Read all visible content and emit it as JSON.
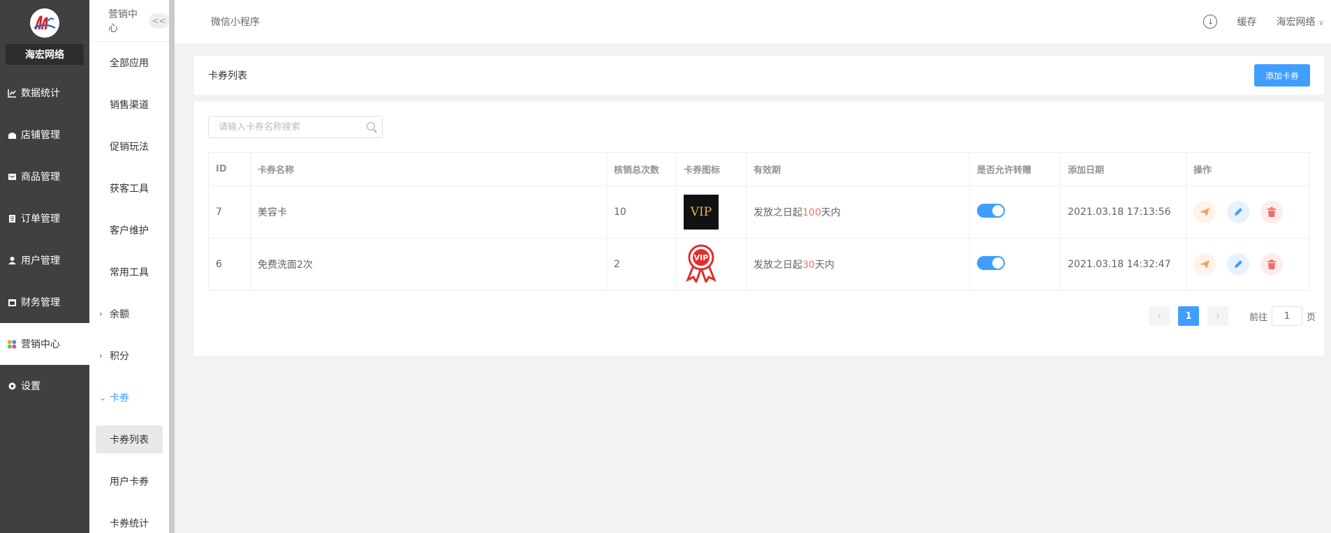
{
  "sidebar": {
    "brand": "海宏网络",
    "items": [
      {
        "label": "数据统计",
        "icon": "chart-line-icon"
      },
      {
        "label": "店铺管理",
        "icon": "shop-icon"
      },
      {
        "label": "商品管理",
        "icon": "goods-icon"
      },
      {
        "label": "订单管理",
        "icon": "order-icon"
      },
      {
        "label": "用户管理",
        "icon": "user-icon"
      },
      {
        "label": "财务管理",
        "icon": "finance-icon"
      },
      {
        "label": "营销中心",
        "icon": "marketing-icon",
        "active": true
      },
      {
        "label": "设置",
        "icon": "settings-icon"
      }
    ]
  },
  "subnav": {
    "title": "营销中心",
    "collapse_label": "<<",
    "items": [
      "全部应用",
      "销售渠道",
      "促销玩法",
      "获客工具",
      "客户维护",
      "常用工具"
    ],
    "groups": [
      "余额",
      "积分",
      "卡券"
    ],
    "children": [
      "卡券列表",
      "用户卡券",
      "卡券统计"
    ]
  },
  "header": {
    "title": "微信小程序",
    "cache_label": "缓存",
    "user_label": "海宏网络"
  },
  "card": {
    "title": "卡券列表",
    "add_label": "添加卡券"
  },
  "search": {
    "placeholder": "请输入卡券名称搜索"
  },
  "table": {
    "columns": [
      "ID",
      "卡券名称",
      "核销总次数",
      "卡券图标",
      "有效期",
      "是否允许转赠",
      "添加日期",
      "操作"
    ],
    "rows": [
      {
        "id": "7",
        "name": "美容卡",
        "count": "10",
        "icon_text": "VIP",
        "valid_pre": "发放之日起",
        "valid_num": "100",
        "valid_post": "天内",
        "transfer": true,
        "date": "2021.03.18 17:13:56"
      },
      {
        "id": "6",
        "name": "免费洗面2次",
        "count": "2",
        "icon_text": "VIP",
        "valid_pre": "发放之日起",
        "valid_num": "30",
        "valid_post": "天内",
        "transfer": true,
        "date": "2021.03.18 14:32:47"
      }
    ]
  },
  "pagination": {
    "current": "1",
    "goto_label": "前往",
    "goto_value": "1",
    "page_label": "页"
  },
  "colors": {
    "primary": "#409eff",
    "sidebar": "#404040",
    "danger": "#f56c6c"
  }
}
